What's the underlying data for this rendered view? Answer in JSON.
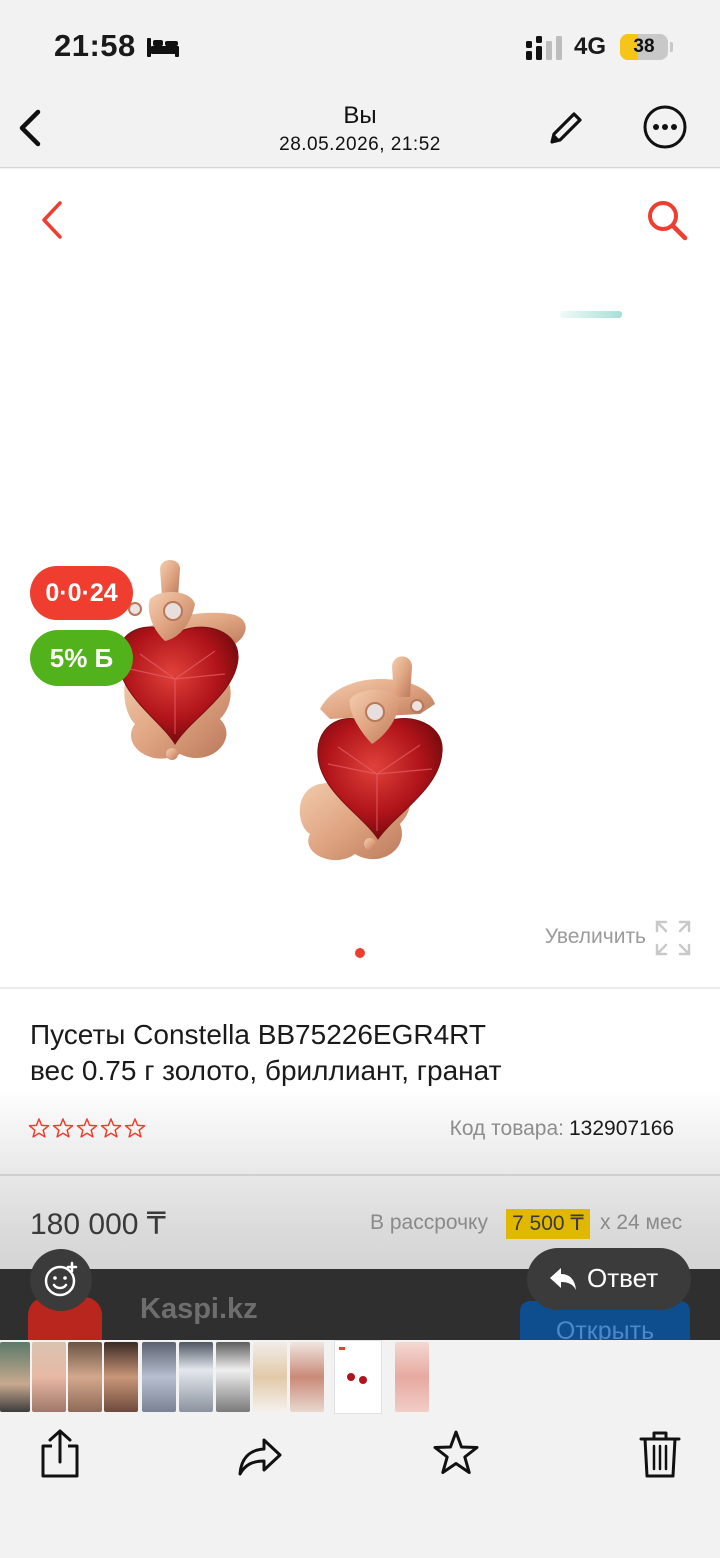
{
  "status_bar": {
    "time": "21:58",
    "network": "4G",
    "battery": "38",
    "battery_level": 0.38,
    "icons": [
      "bed-icon",
      "signal-icon",
      "battery-charging-icon"
    ]
  },
  "nav": {
    "title": "Вы",
    "subtitle": "28.05.2026, 21:52",
    "icons": [
      "chevron-left-icon",
      "pencil-icon",
      "more-icon"
    ]
  },
  "screenshot": {
    "icons": [
      "chevron-left-icon",
      "search-icon",
      "expand-icon"
    ],
    "accent_color": "#ef3d2f",
    "badges": {
      "installment": "0·0·24",
      "bonus": "5% Б"
    },
    "zoom_label": "Увеличить",
    "product": {
      "title_line1": "Пусеты Constella BB75226EGR4RT",
      "title_line2": "вес 0.75 г золото, бриллиант, гранат",
      "rating": 0,
      "code_label": "Код товара:",
      "code_value": "132907166",
      "price": "180 000 ₸",
      "installment_label": "В рассрочку",
      "installment_amount": "7 500 ₸",
      "installment_term": "х 24 мес"
    },
    "banner": {
      "app_name": "Kaspi.kz",
      "open_label": "Открыть"
    }
  },
  "overlay": {
    "reply_label": "Ответ",
    "icons": [
      "emoji-add-icon",
      "reply-icon"
    ]
  },
  "toolbar": {
    "icons": [
      "share-icon",
      "forward-icon",
      "star-icon",
      "trash-icon"
    ]
  }
}
